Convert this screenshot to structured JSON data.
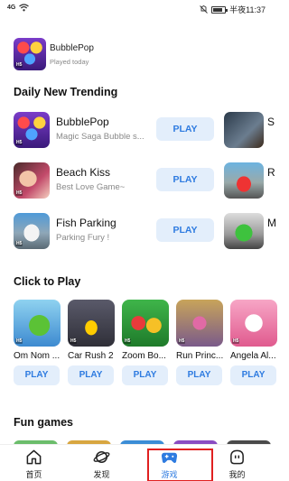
{
  "status_bar": {
    "signal_text": "4G",
    "time": "半夜11:37",
    "icons": [
      "sim-icon",
      "wifi-icon",
      "mute-icon",
      "battery-icon"
    ]
  },
  "recent": {
    "name": "BubblePop",
    "subtitle": "Played today",
    "icon": "bubblepop-thumb"
  },
  "sections": {
    "daily": "Daily New Trending",
    "click": "Click to Play",
    "fun": "Fun games"
  },
  "trending": [
    {
      "name": "BubblePop",
      "subtitle": "Magic Saga Bubble s...",
      "play": "PLAY",
      "side_label": "S"
    },
    {
      "name": "Beach Kiss",
      "subtitle": "Best Love Game~",
      "play": "PLAY",
      "side_label": "R"
    },
    {
      "name": "Fish Parking",
      "subtitle": "Parking Fury !",
      "play": "PLAY",
      "side_label": "M"
    }
  ],
  "click_to_play": [
    {
      "name": "Om Nom ...",
      "play": "PLAY"
    },
    {
      "name": "Car Rush 2",
      "play": "PLAY"
    },
    {
      "name": "Zoom Bo...",
      "play": "PLAY"
    },
    {
      "name": "Run Princ...",
      "play": "PLAY"
    },
    {
      "name": "Angela Al...",
      "play": "PLAY"
    }
  ],
  "badge_text": "H5",
  "bottom_nav": {
    "items": [
      {
        "label": "首页",
        "icon": "home-icon"
      },
      {
        "label": "发现",
        "icon": "planet-icon"
      },
      {
        "label": "游戏",
        "icon": "gamepad-icon"
      },
      {
        "label": "我的",
        "icon": "profile-icon"
      }
    ],
    "active_index": 2
  },
  "colors": {
    "accent": "#2e7be0",
    "play_bg": "#e3eefb",
    "highlight": "#e02020"
  }
}
